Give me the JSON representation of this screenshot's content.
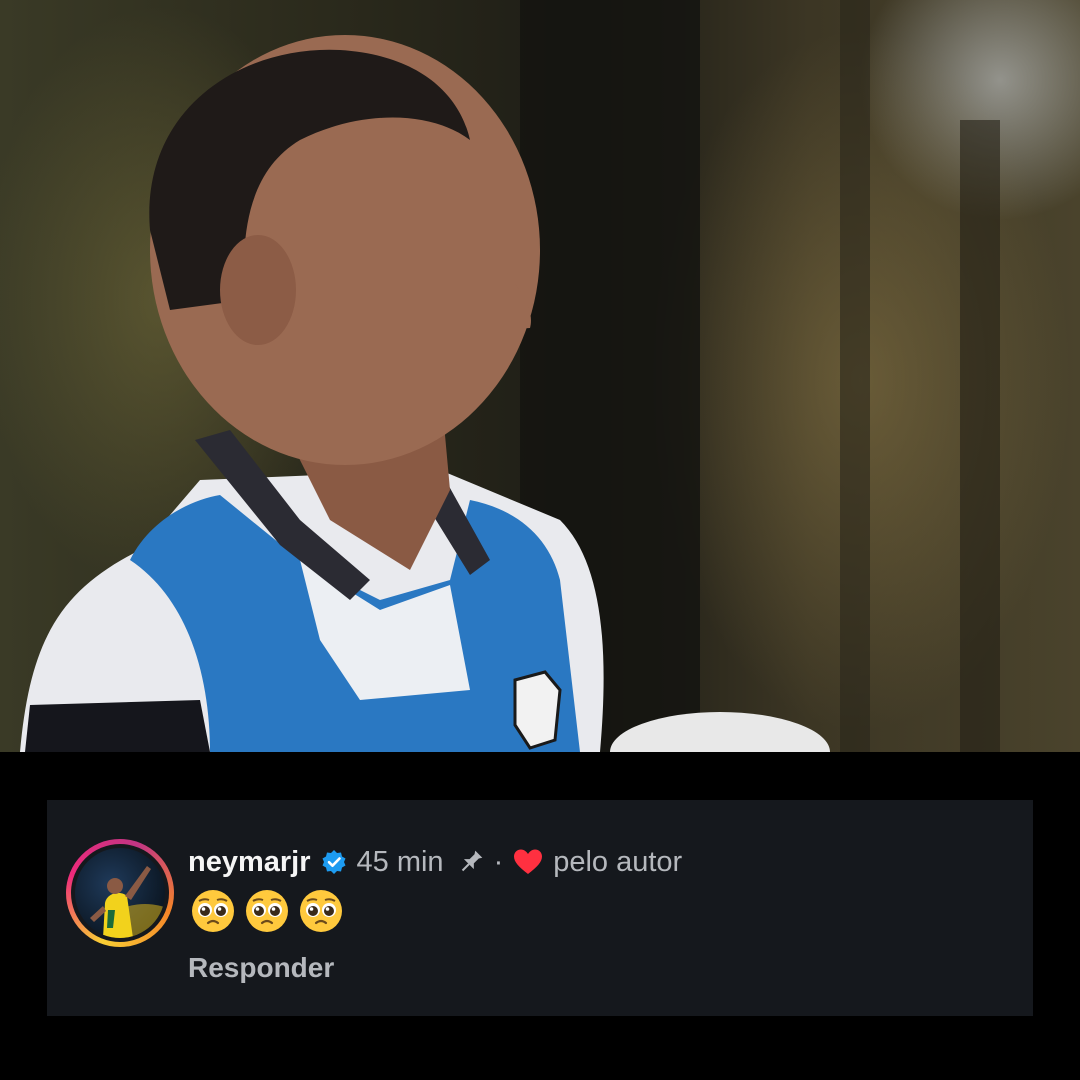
{
  "photo": {
    "alt": "Menino com colete azul do Santos segurando uma bola"
  },
  "comment": {
    "username": "neymarjr",
    "verified": true,
    "time": "45 min",
    "separator": "·",
    "liked_by_author_label": "pelo autor",
    "emoji_count": 3,
    "emoji_name": "pleading-face-emoji",
    "reply_label": "Responder"
  },
  "colors": {
    "background": "#000000",
    "card": "#15181d",
    "username": "#f5f5f5",
    "meta_text": "#b5b8bd",
    "verified_badge": "#1d9bf0",
    "heart": "#ff3040",
    "jersey_blue": "#2a78c2"
  },
  "icons": [
    "verified-badge-icon",
    "pin-icon",
    "heart-icon"
  ]
}
